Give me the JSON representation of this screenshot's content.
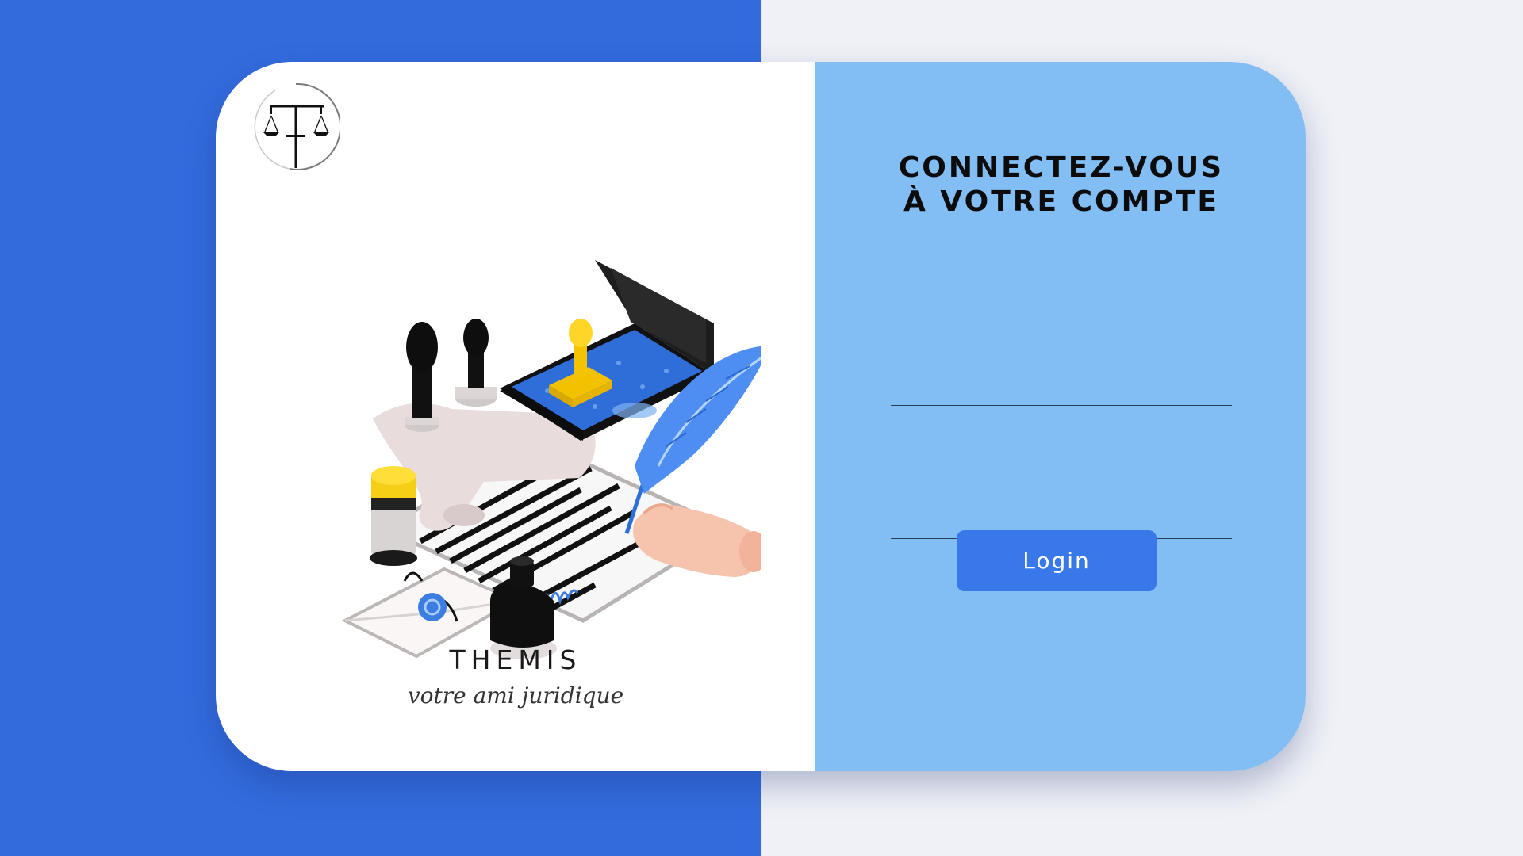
{
  "brand": {
    "name": "THEMIS",
    "tagline": "votre ami juridique"
  },
  "login": {
    "title_line1": "CONNECTEZ-VOUS",
    "title_line2": "À VOTRE COMPTE",
    "username_value": "",
    "password_value": "",
    "button_label": "Login"
  },
  "icons": {
    "logo": "scales-of-justice-icon",
    "illustration": "notary-desk-illustration"
  },
  "colors": {
    "left_background": "#336bdd",
    "right_background": "#eff1f6",
    "card_left": "#ffffff",
    "card_right": "#82bdf4",
    "button": "#3978e8"
  }
}
